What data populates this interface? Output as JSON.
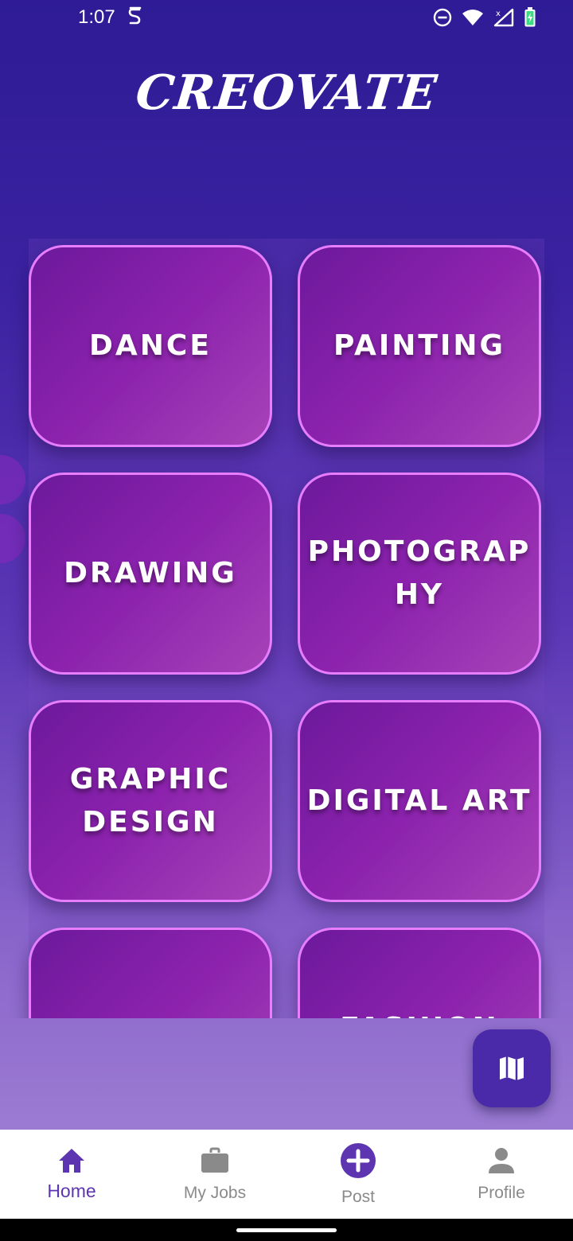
{
  "status_bar": {
    "time": "1:07"
  },
  "app": {
    "title": "CREOVATE"
  },
  "categories": [
    {
      "label": "DANCE"
    },
    {
      "label": "PAINTING"
    },
    {
      "label": "DRAWING"
    },
    {
      "label": "PHOTOGRAPHY"
    },
    {
      "label": "GRAPHIC DESIGN"
    },
    {
      "label": "DIGITAL ART"
    },
    {
      "label": ""
    },
    {
      "label": "FASHION"
    }
  ],
  "bottom_nav": {
    "items": [
      {
        "label": "Home",
        "icon": "home-icon",
        "active": true
      },
      {
        "label": "My Jobs",
        "icon": "briefcase-icon",
        "active": false
      },
      {
        "label": "Post",
        "icon": "add-circle-icon",
        "active": false
      },
      {
        "label": "Profile",
        "icon": "person-icon",
        "active": false
      }
    ]
  },
  "fab": {
    "icon": "map-icon"
  },
  "colors": {
    "accent": "#5e35b1",
    "card_border": "#e87dff",
    "fab": "#4a2aa8"
  }
}
